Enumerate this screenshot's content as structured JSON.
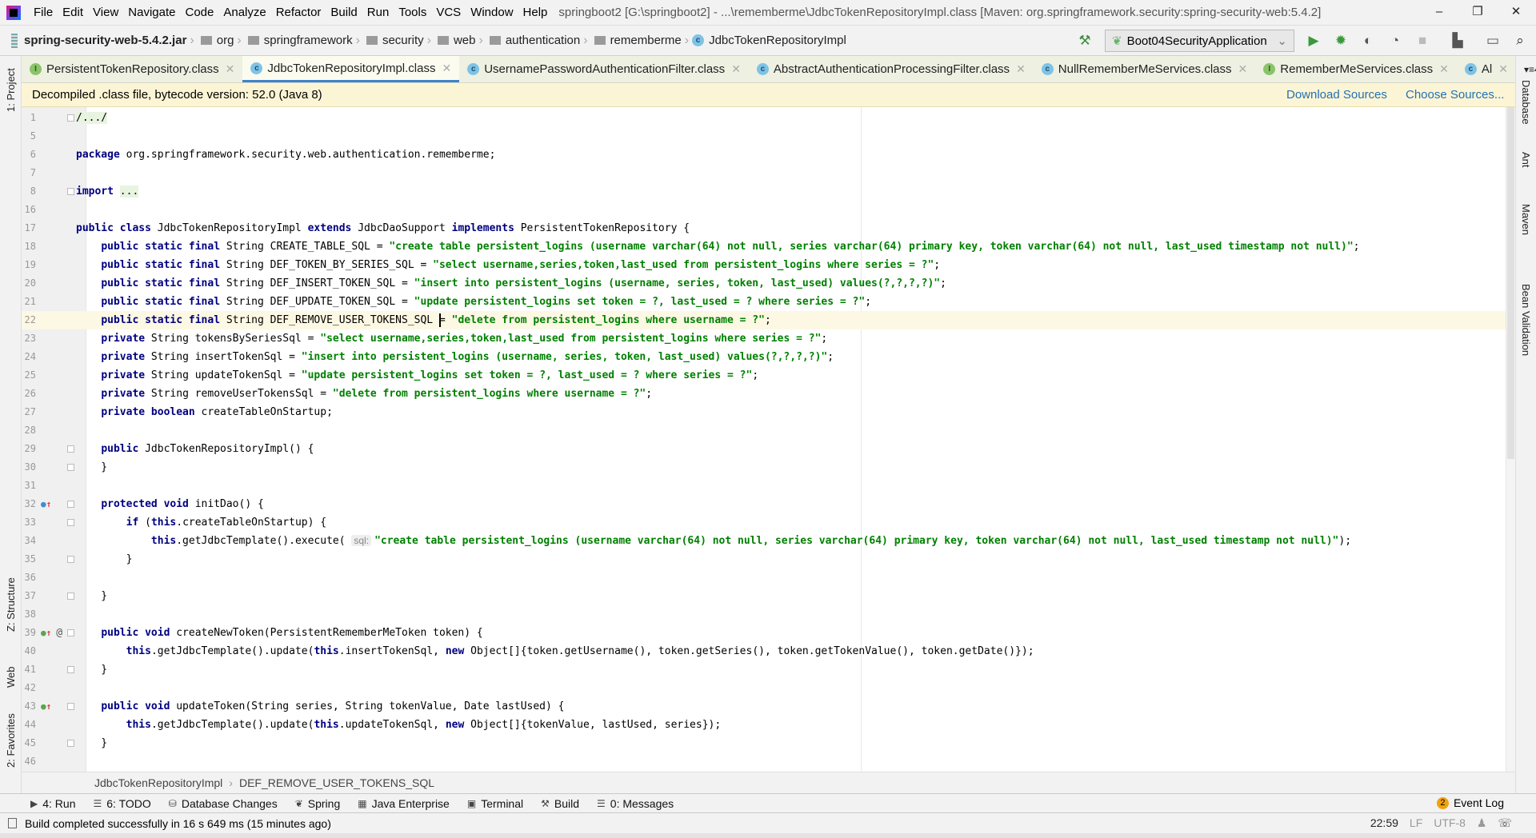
{
  "menubar": {
    "items": [
      "File",
      "Edit",
      "View",
      "Navigate",
      "Code",
      "Analyze",
      "Refactor",
      "Build",
      "Run",
      "Tools",
      "VCS",
      "Window",
      "Help"
    ],
    "title": "springboot2 [G:\\springboot2] - ...\\rememberme\\JdbcTokenRepositoryImpl.class [Maven: org.springframework.security:spring-security-web:5.4.2]",
    "controls": {
      "minimize": "–",
      "restore": "❐",
      "close": "✕"
    }
  },
  "navbar": {
    "jar": "spring-security-web-5.4.2.jar",
    "folders": [
      "org",
      "springframework",
      "security",
      "web",
      "authentication",
      "rememberme"
    ],
    "class": "JdbcTokenRepositoryImpl",
    "run_config": "Boot04SecurityApplication"
  },
  "tabs": [
    {
      "label": "PersistentTokenRepository.class",
      "kind": "I",
      "active": false
    },
    {
      "label": "JdbcTokenRepositoryImpl.class",
      "kind": "C",
      "active": true
    },
    {
      "label": "UsernamePasswordAuthenticationFilter.class",
      "kind": "C",
      "active": false
    },
    {
      "label": "AbstractAuthenticationProcessingFilter.class",
      "kind": "C",
      "active": false
    },
    {
      "label": "NullRememberMeServices.class",
      "kind": "C",
      "active": false
    },
    {
      "label": "RememberMeServices.class",
      "kind": "I",
      "active": false
    },
    {
      "label": "Al",
      "kind": "C",
      "active": false
    }
  ],
  "tab_overflow": "4",
  "notice": {
    "text": "Decompiled .class file, bytecode version: 52.0 (Java 8)",
    "download": "Download Sources",
    "choose": "Choose Sources..."
  },
  "left_stripe": [
    "1: Project",
    "Z: Structure",
    "Web",
    "2: Favorites"
  ],
  "right_stripe": [
    "Database",
    "Ant",
    "Maven",
    "Bean Validation"
  ],
  "code": [
    {
      "n": "1",
      "fold": true,
      "t": [
        [
          "f",
          "/.../"
        ]
      ]
    },
    {
      "n": "5",
      "t": []
    },
    {
      "n": "6",
      "t": [
        [
          "k",
          "package"
        ],
        [
          "p",
          " org.springframework.security.web.authentication.rememberme;"
        ]
      ]
    },
    {
      "n": "7",
      "t": []
    },
    {
      "n": "8",
      "fold": true,
      "t": [
        [
          "k",
          "import"
        ],
        [
          "p",
          " "
        ],
        [
          "f",
          "..."
        ]
      ]
    },
    {
      "n": "16",
      "t": []
    },
    {
      "n": "17",
      "t": [
        [
          "k",
          "public class"
        ],
        [
          "p",
          " JdbcTokenRepositoryImpl "
        ],
        [
          "k",
          "extends"
        ],
        [
          "p",
          " JdbcDaoSupport "
        ],
        [
          "k",
          "implements"
        ],
        [
          "p",
          " PersistentTokenRepository {"
        ]
      ]
    },
    {
      "n": "18",
      "t": [
        [
          "p",
          "    "
        ],
        [
          "k",
          "public static final"
        ],
        [
          "p",
          " String CREATE_TABLE_SQL = "
        ],
        [
          "s",
          "\"create table persistent_logins (username varchar(64) not null, series varchar(64) primary key, token varchar(64) not null, last_used timestamp not null)\""
        ],
        [
          "p",
          ";"
        ]
      ]
    },
    {
      "n": "19",
      "t": [
        [
          "p",
          "    "
        ],
        [
          "k",
          "public static final"
        ],
        [
          "p",
          " String DEF_TOKEN_BY_SERIES_SQL = "
        ],
        [
          "s",
          "\"select username,series,token,last_used from persistent_logins where series = ?\""
        ],
        [
          "p",
          ";"
        ]
      ]
    },
    {
      "n": "20",
      "t": [
        [
          "p",
          "    "
        ],
        [
          "k",
          "public static final"
        ],
        [
          "p",
          " String DEF_INSERT_TOKEN_SQL = "
        ],
        [
          "s",
          "\"insert into persistent_logins (username, series, token, last_used) values(?,?,?,?)\""
        ],
        [
          "p",
          ";"
        ]
      ]
    },
    {
      "n": "21",
      "t": [
        [
          "p",
          "    "
        ],
        [
          "k",
          "public static final"
        ],
        [
          "p",
          " String DEF_UPDATE_TOKEN_SQL = "
        ],
        [
          "s",
          "\"update persistent_logins set token = ?, last_used = ? where series = ?\""
        ],
        [
          "p",
          ";"
        ]
      ]
    },
    {
      "n": "22",
      "current": true,
      "t": [
        [
          "p",
          "    "
        ],
        [
          "k",
          "public static final"
        ],
        [
          "p",
          " String DEF_REMOVE_USER_TOKENS_SQL "
        ],
        [
          "c",
          ""
        ],
        [
          "p",
          "= "
        ],
        [
          "s",
          "\"delete from persistent_logins where username = ?\""
        ],
        [
          "p",
          ";"
        ]
      ]
    },
    {
      "n": "23",
      "t": [
        [
          "p",
          "    "
        ],
        [
          "k",
          "private"
        ],
        [
          "p",
          " String tokensBySeriesSql = "
        ],
        [
          "s",
          "\"select username,series,token,last_used from persistent_logins where series = ?\""
        ],
        [
          "p",
          ";"
        ]
      ]
    },
    {
      "n": "24",
      "t": [
        [
          "p",
          "    "
        ],
        [
          "k",
          "private"
        ],
        [
          "p",
          " String insertTokenSql = "
        ],
        [
          "s",
          "\"insert into persistent_logins (username, series, token, last_used) values(?,?,?,?)\""
        ],
        [
          "p",
          ";"
        ]
      ]
    },
    {
      "n": "25",
      "t": [
        [
          "p",
          "    "
        ],
        [
          "k",
          "private"
        ],
        [
          "p",
          " String updateTokenSql = "
        ],
        [
          "s",
          "\"update persistent_logins set token = ?, last_used = ? where series = ?\""
        ],
        [
          "p",
          ";"
        ]
      ]
    },
    {
      "n": "26",
      "t": [
        [
          "p",
          "    "
        ],
        [
          "k",
          "private"
        ],
        [
          "p",
          " String removeUserTokensSql = "
        ],
        [
          "s",
          "\"delete from persistent_logins where username = ?\""
        ],
        [
          "p",
          ";"
        ]
      ]
    },
    {
      "n": "27",
      "t": [
        [
          "p",
          "    "
        ],
        [
          "k",
          "private boolean"
        ],
        [
          "p",
          " createTableOnStartup;"
        ]
      ]
    },
    {
      "n": "28",
      "t": []
    },
    {
      "n": "29",
      "fold": true,
      "t": [
        [
          "p",
          "    "
        ],
        [
          "k",
          "public"
        ],
        [
          "p",
          " JdbcTokenRepositoryImpl() {"
        ]
      ]
    },
    {
      "n": "30",
      "fold": true,
      "t": [
        [
          "p",
          "    }"
        ]
      ]
    },
    {
      "n": "31",
      "t": []
    },
    {
      "n": "32",
      "fold": true,
      "gicon": "override",
      "t": [
        [
          "p",
          "    "
        ],
        [
          "k",
          "protected void"
        ],
        [
          "p",
          " initDao() {"
        ]
      ]
    },
    {
      "n": "33",
      "fold": true,
      "t": [
        [
          "p",
          "        "
        ],
        [
          "k",
          "if"
        ],
        [
          "p",
          " ("
        ],
        [
          "k",
          "this"
        ],
        [
          "p",
          ".createTableOnStartup) {"
        ]
      ]
    },
    {
      "n": "34",
      "t": [
        [
          "p",
          "            "
        ],
        [
          "k",
          "this"
        ],
        [
          "p",
          ".getJdbcTemplate().execute( "
        ],
        [
          "h",
          "sql:"
        ],
        [
          "s",
          "\"create table persistent_logins (username varchar(64) not null, series varchar(64) primary key, token varchar(64) not null, last_used timestamp not null)\""
        ],
        [
          "p",
          ");"
        ]
      ]
    },
    {
      "n": "35",
      "fold": true,
      "t": [
        [
          "p",
          "        }"
        ]
      ]
    },
    {
      "n": "36",
      "t": []
    },
    {
      "n": "37",
      "fold": true,
      "t": [
        [
          "p",
          "    }"
        ]
      ]
    },
    {
      "n": "38",
      "t": []
    },
    {
      "n": "39",
      "fold": true,
      "gicon": "implements-annotated",
      "t": [
        [
          "p",
          "    "
        ],
        [
          "k",
          "public void"
        ],
        [
          "p",
          " createNewToken(PersistentRememberMeToken token) {"
        ]
      ]
    },
    {
      "n": "40",
      "t": [
        [
          "p",
          "        "
        ],
        [
          "k",
          "this"
        ],
        [
          "p",
          ".getJdbcTemplate().update("
        ],
        [
          "k",
          "this"
        ],
        [
          "p",
          ".insertTokenSql, "
        ],
        [
          "k",
          "new"
        ],
        [
          "p",
          " Object[]{token.getUsername(), token.getSeries(), token.getTokenValue(), token.getDate()});"
        ]
      ]
    },
    {
      "n": "41",
      "fold": true,
      "t": [
        [
          "p",
          "    }"
        ]
      ]
    },
    {
      "n": "42",
      "t": []
    },
    {
      "n": "43",
      "fold": true,
      "gicon": "implements",
      "t": [
        [
          "p",
          "    "
        ],
        [
          "k",
          "public void"
        ],
        [
          "p",
          " updateToken(String series, String tokenValue, Date lastUsed) {"
        ]
      ]
    },
    {
      "n": "44",
      "t": [
        [
          "p",
          "        "
        ],
        [
          "k",
          "this"
        ],
        [
          "p",
          ".getJdbcTemplate().update("
        ],
        [
          "k",
          "this"
        ],
        [
          "p",
          ".updateTokenSql, "
        ],
        [
          "k",
          "new"
        ],
        [
          "p",
          " Object[]{tokenValue, lastUsed, series});"
        ]
      ]
    },
    {
      "n": "45",
      "fold": true,
      "t": [
        [
          "p",
          "    }"
        ]
      ]
    },
    {
      "n": "46",
      "t": []
    }
  ],
  "breadcrumb": {
    "class": "JdbcTokenRepositoryImpl",
    "member": "DEF_REMOVE_USER_TOKENS_SQL",
    "sep": "›"
  },
  "toolwindows": [
    {
      "icon": "▶",
      "label": "4: Run"
    },
    {
      "icon": "☰",
      "label": "6: TODO"
    },
    {
      "icon": "⛁",
      "label": "Database Changes"
    },
    {
      "icon": "❦",
      "label": "Spring"
    },
    {
      "icon": "▦",
      "label": "Java Enterprise"
    },
    {
      "icon": "▣",
      "label": "Terminal"
    },
    {
      "icon": "⚒",
      "label": "Build"
    },
    {
      "icon": "☰",
      "label": "0: Messages"
    }
  ],
  "event_log": {
    "count": "2",
    "label": "Event Log"
  },
  "status": {
    "message": "Build completed successfully in 16 s 649 ms (15 minutes ago)",
    "position": "22:59",
    "line_sep": "LF",
    "encoding": "UTF-8"
  },
  "colors": {
    "keyword": "#000080",
    "string": "#008000",
    "accent": "#4083c9",
    "notice_bg": "#fcf5d5",
    "link": "#2470b3"
  }
}
